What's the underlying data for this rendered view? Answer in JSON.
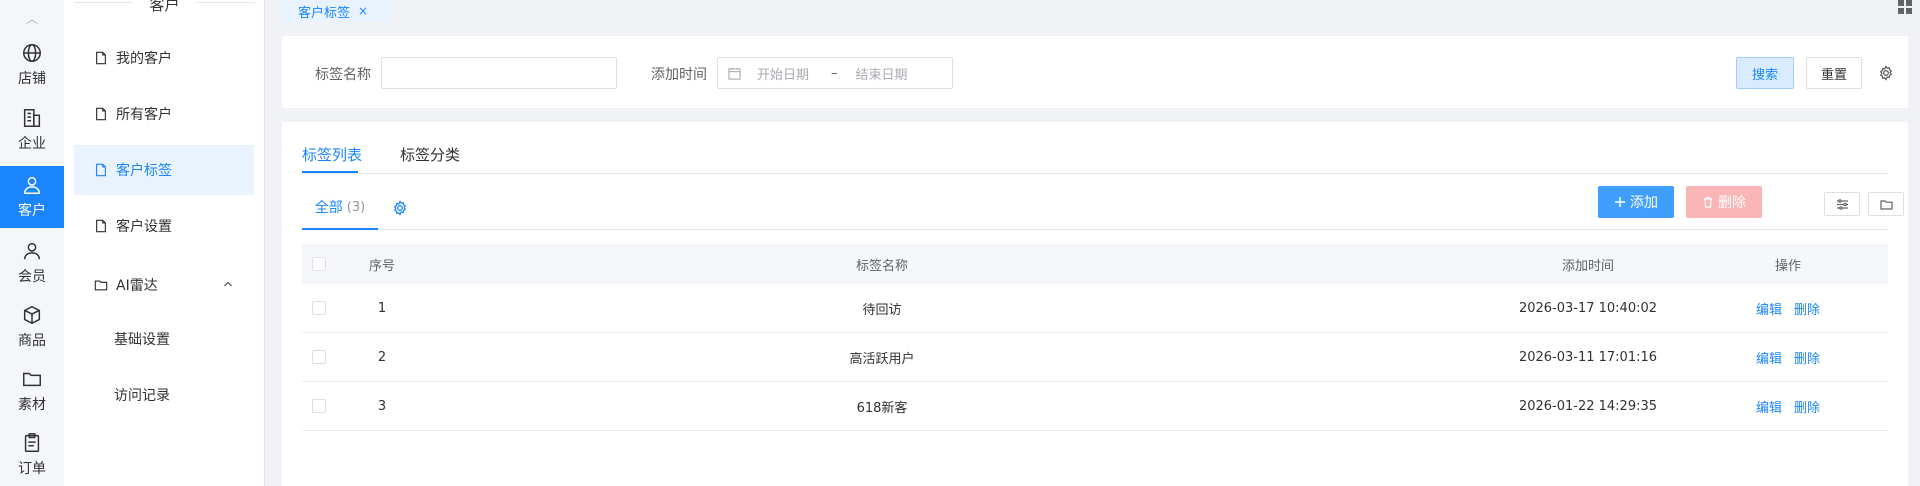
{
  "rail": {
    "items": [
      {
        "label": "店铺",
        "icon": "globe-icon"
      },
      {
        "label": "企业",
        "icon": "building-icon"
      },
      {
        "label": "客户",
        "icon": "user-icon",
        "active": true
      },
      {
        "label": "会员",
        "icon": "member-icon"
      },
      {
        "label": "商品",
        "icon": "box-icon"
      },
      {
        "label": "素材",
        "icon": "folder-icon"
      },
      {
        "label": "订单",
        "icon": "clipboard-icon"
      }
    ]
  },
  "submenu": {
    "title": "客户",
    "items": [
      {
        "label": "我的客户"
      },
      {
        "label": "所有客户"
      },
      {
        "label": "客户标签",
        "active": true
      },
      {
        "label": "客户设置"
      },
      {
        "label": "AI雷达"
      }
    ],
    "ai_children": [
      "基础设置",
      "访问记录"
    ]
  },
  "tabstrip": {
    "active_tab": "客户标签",
    "close": "×"
  },
  "search": {
    "tag_name_label": "标签名称",
    "tag_name_value": "",
    "add_time_label": "添加时间",
    "start_placeholder": "开始日期",
    "range_sep": "–",
    "end_placeholder": "结束日期",
    "search_button": "搜索",
    "reset_button": "重置"
  },
  "main": {
    "tabs": [
      {
        "label": "标签列表",
        "active": true
      },
      {
        "label": "标签分类"
      }
    ],
    "filter": {
      "segment_label": "全部",
      "segment_count": "(3)"
    },
    "add_button": "添加",
    "delete_button": "删除"
  },
  "table": {
    "headers": [
      "序号",
      "标签名称",
      "添加时间",
      "操作"
    ],
    "rows": [
      {
        "no": "1",
        "name": "待回访",
        "time": "2026-03-17 10:40:02"
      },
      {
        "no": "2",
        "name": "高活跃用户",
        "time": "2026-03-11 17:01:16"
      },
      {
        "no": "3",
        "name": "618新客",
        "time": "2026-01-22 14:29:35"
      }
    ],
    "edit_label": "编辑",
    "delete_label": "删除"
  },
  "colors": {
    "accent": "#1a85ff",
    "danger_disabled": "#fab6b6",
    "primary_button": "#409eff"
  }
}
